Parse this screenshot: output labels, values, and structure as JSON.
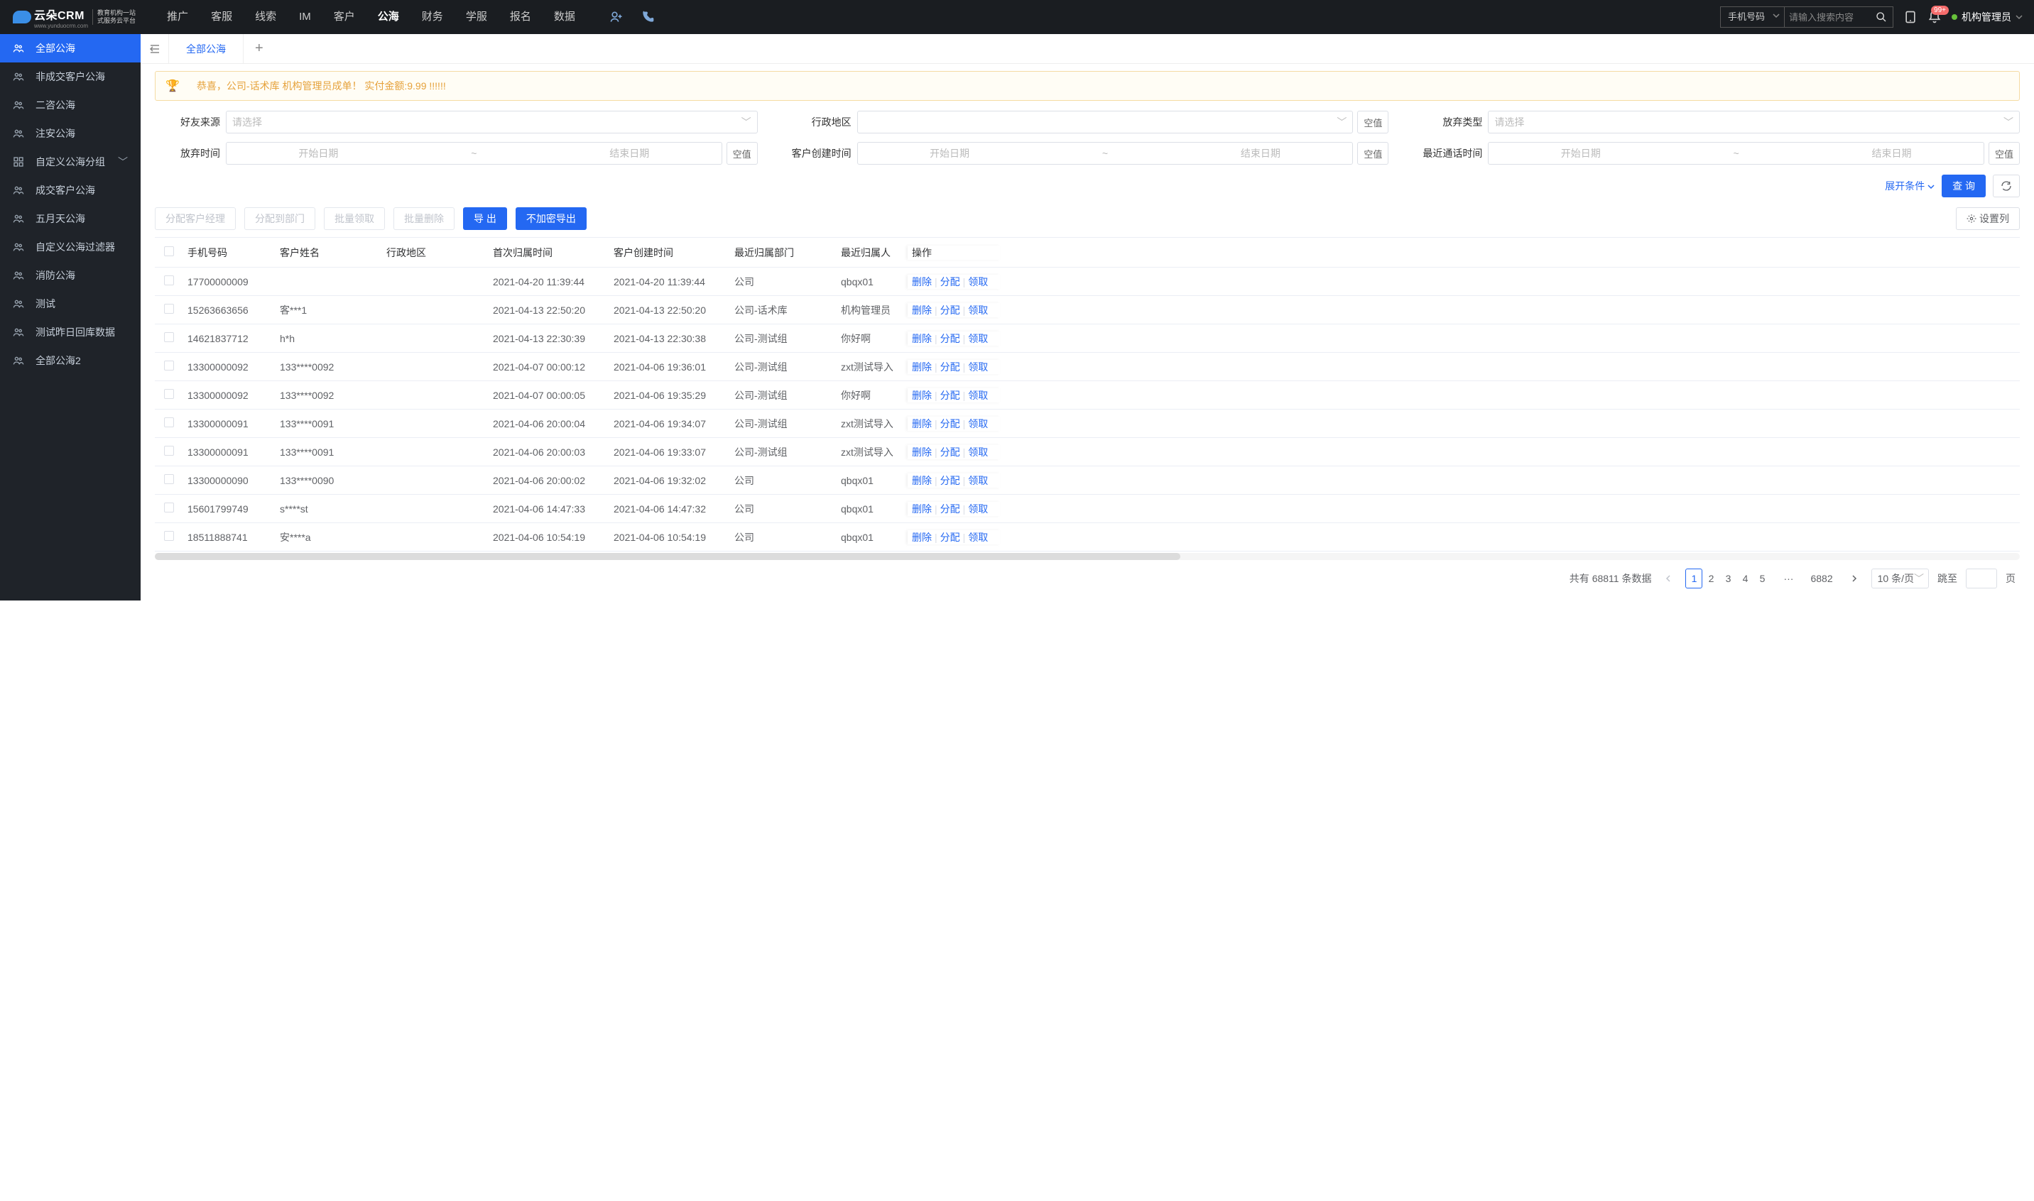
{
  "logo": {
    "brand": "云朵CRM",
    "sub1": "教育机构一站",
    "sub2": "式服务云平台",
    "url": "www.yunduocrm.com"
  },
  "topnav": [
    "推广",
    "客服",
    "线索",
    "IM",
    "客户",
    "公海",
    "财务",
    "学服",
    "报名",
    "数据"
  ],
  "topnav_active": 5,
  "search": {
    "type": "手机号码",
    "placeholder": "请输入搜索内容"
  },
  "notif_badge": "99+",
  "user": "机构管理员",
  "sidebar": [
    {
      "icon": "users",
      "label": "全部公海",
      "active": true
    },
    {
      "icon": "users",
      "label": "非成交客户公海"
    },
    {
      "icon": "users",
      "label": "二咨公海"
    },
    {
      "icon": "users",
      "label": "注安公海"
    },
    {
      "icon": "grid",
      "label": "自定义公海分组",
      "expandable": true
    },
    {
      "icon": "users",
      "label": "成交客户公海"
    },
    {
      "icon": "users",
      "label": "五月天公海"
    },
    {
      "icon": "users",
      "label": "自定义公海过滤器"
    },
    {
      "icon": "users",
      "label": "消防公海"
    },
    {
      "icon": "users",
      "label": "测试"
    },
    {
      "icon": "users",
      "label": "测试昨日回库数据"
    },
    {
      "icon": "users",
      "label": "全部公海2"
    }
  ],
  "tab": "全部公海",
  "banner": "恭喜，公司-话术库 机构管理员成单！ 实付金额:9.99 !!!!!!",
  "filters": {
    "friend_source": {
      "label": "好友来源",
      "placeholder": "请选择"
    },
    "district": {
      "label": "行政地区",
      "placeholder": "",
      "null_btn": "空值"
    },
    "abandon_type": {
      "label": "放弃类型",
      "placeholder": "请选择"
    },
    "abandon_time": {
      "label": "放弃时间",
      "start": "开始日期",
      "end": "结束日期",
      "null_btn": "空值"
    },
    "create_time": {
      "label": "客户创建时间",
      "start": "开始日期",
      "end": "结束日期",
      "null_btn": "空值"
    },
    "last_call_time": {
      "label": "最近通话时间",
      "start": "开始日期",
      "end": "结束日期",
      "null_btn": "空值"
    },
    "expand": "展开条件",
    "query": "查 询"
  },
  "toolbar": {
    "assign_mgr": "分配客户经理",
    "assign_dept": "分配到部门",
    "batch_claim": "批量领取",
    "batch_delete": "批量删除",
    "export": "导 出",
    "export_plain": "不加密导出",
    "columns": "设置列"
  },
  "columns": [
    "",
    "手机号码",
    "客户姓名",
    "行政地区",
    "首次归属时间",
    "客户创建时间",
    "最近归属部门",
    "最近归属人",
    "操作"
  ],
  "ops": {
    "delete": "删除",
    "assign": "分配",
    "claim": "领取"
  },
  "rows": [
    {
      "phone": "17700000009",
      "name": "",
      "district": "",
      "first_time": "2021-04-20 11:39:44",
      "create_time": "2021-04-20 11:39:44",
      "dept": "公司",
      "owner": "qbqx01"
    },
    {
      "phone": "15263663656",
      "name": "客***1",
      "district": "",
      "first_time": "2021-04-13 22:50:20",
      "create_time": "2021-04-13 22:50:20",
      "dept": "公司-话术库",
      "owner": "机构管理员"
    },
    {
      "phone": "14621837712",
      "name": "h*h",
      "district": "",
      "first_time": "2021-04-13 22:30:39",
      "create_time": "2021-04-13 22:30:38",
      "dept": "公司-测试组",
      "owner": "你好啊"
    },
    {
      "phone": "13300000092",
      "name": "133****0092",
      "district": "",
      "first_time": "2021-04-07 00:00:12",
      "create_time": "2021-04-06 19:36:01",
      "dept": "公司-测试组",
      "owner": "zxt测试导入"
    },
    {
      "phone": "13300000092",
      "name": "133****0092",
      "district": "",
      "first_time": "2021-04-07 00:00:05",
      "create_time": "2021-04-06 19:35:29",
      "dept": "公司-测试组",
      "owner": "你好啊"
    },
    {
      "phone": "13300000091",
      "name": "133****0091",
      "district": "",
      "first_time": "2021-04-06 20:00:04",
      "create_time": "2021-04-06 19:34:07",
      "dept": "公司-测试组",
      "owner": "zxt测试导入"
    },
    {
      "phone": "13300000091",
      "name": "133****0091",
      "district": "",
      "first_time": "2021-04-06 20:00:03",
      "create_time": "2021-04-06 19:33:07",
      "dept": "公司-测试组",
      "owner": "zxt测试导入"
    },
    {
      "phone": "13300000090",
      "name": "133****0090",
      "district": "",
      "first_time": "2021-04-06 20:00:02",
      "create_time": "2021-04-06 19:32:02",
      "dept": "公司",
      "owner": "qbqx01"
    },
    {
      "phone": "15601799749",
      "name": "s****st",
      "district": "",
      "first_time": "2021-04-06 14:47:33",
      "create_time": "2021-04-06 14:47:32",
      "dept": "公司",
      "owner": "qbqx01"
    },
    {
      "phone": "18511888741",
      "name": "安****a",
      "district": "",
      "first_time": "2021-04-06 10:54:19",
      "create_time": "2021-04-06 10:54:19",
      "dept": "公司",
      "owner": "qbqx01"
    }
  ],
  "pagination": {
    "total_prefix": "共有",
    "total": "68811",
    "total_suffix": "条数据",
    "pages": [
      "1",
      "2",
      "3",
      "4",
      "5"
    ],
    "last": "6882",
    "per_page": "10 条/页",
    "jump_prefix": "跳至",
    "jump_suffix": "页"
  }
}
